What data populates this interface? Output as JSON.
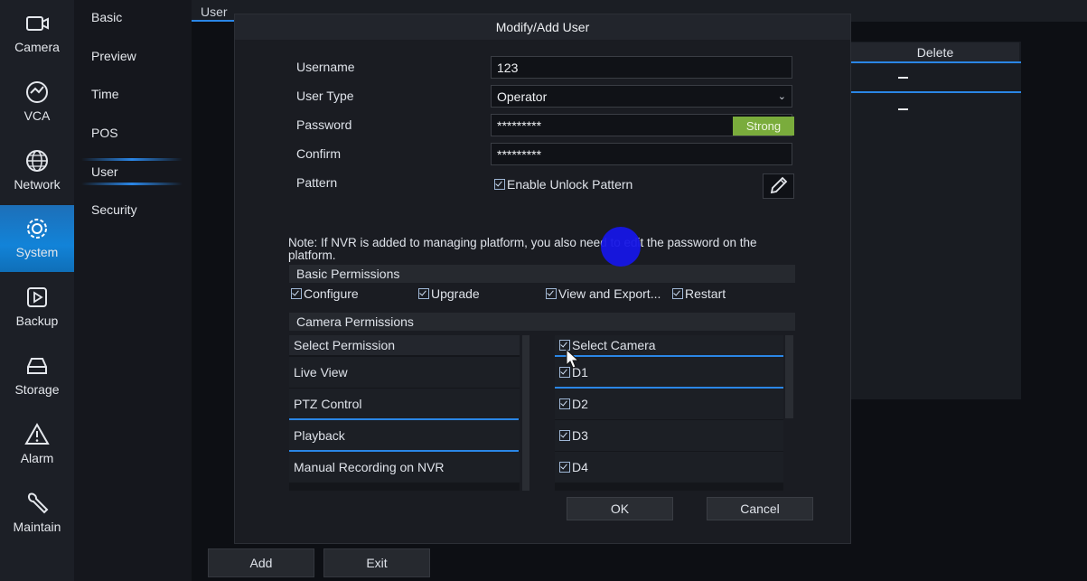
{
  "rail": {
    "items": [
      {
        "label": "Camera",
        "icon": "camera-icon"
      },
      {
        "label": "VCA",
        "icon": "vca-icon"
      },
      {
        "label": "Network",
        "icon": "network-globe-icon"
      },
      {
        "label": "System",
        "icon": "gear-icon",
        "active": true
      },
      {
        "label": "Backup",
        "icon": "backup-icon"
      },
      {
        "label": "Storage",
        "icon": "storage-icon"
      },
      {
        "label": "Alarm",
        "icon": "alarm-icon"
      },
      {
        "label": "Maintain",
        "icon": "wrench-icon"
      }
    ]
  },
  "submenu": {
    "items": [
      "Basic",
      "Preview",
      "Time",
      "POS",
      "User",
      "Security"
    ],
    "selected": "User"
  },
  "page": {
    "tab": "User",
    "table_delete_header": "Delete",
    "add_button": "Add",
    "exit_button": "Exit"
  },
  "dialog": {
    "title": "Modify/Add User",
    "username_label": "Username",
    "username_value": "123",
    "usertype_label": "User Type",
    "usertype_value": "Operator",
    "password_label": "Password",
    "password_value": "*********",
    "password_strength": "Strong",
    "confirm_label": "Confirm",
    "confirm_value": "*********",
    "pattern_label": "Pattern",
    "pattern_checkbox": "Enable Unlock Pattern",
    "note": "Note: If NVR is added to managing platform, you also need to edit the password on the platform.",
    "basic_permissions_title": "Basic Permissions",
    "basic_permissions": [
      "Configure",
      "Upgrade",
      "View and Export...",
      "Restart"
    ],
    "camera_permissions_title": "Camera Permissions",
    "select_permission_header": "Select Permission",
    "permissions": [
      "Live View",
      "PTZ Control",
      "Playback",
      "Manual Recording on NVR"
    ],
    "select_camera_header": "Select Camera",
    "cameras": [
      "D1",
      "D2",
      "D3",
      "D4"
    ],
    "ok_button": "OK",
    "cancel_button": "Cancel"
  },
  "colors": {
    "accent": "#2a86e6",
    "active_nav": "#1283d8",
    "strength_strong": "#7aac3c"
  }
}
